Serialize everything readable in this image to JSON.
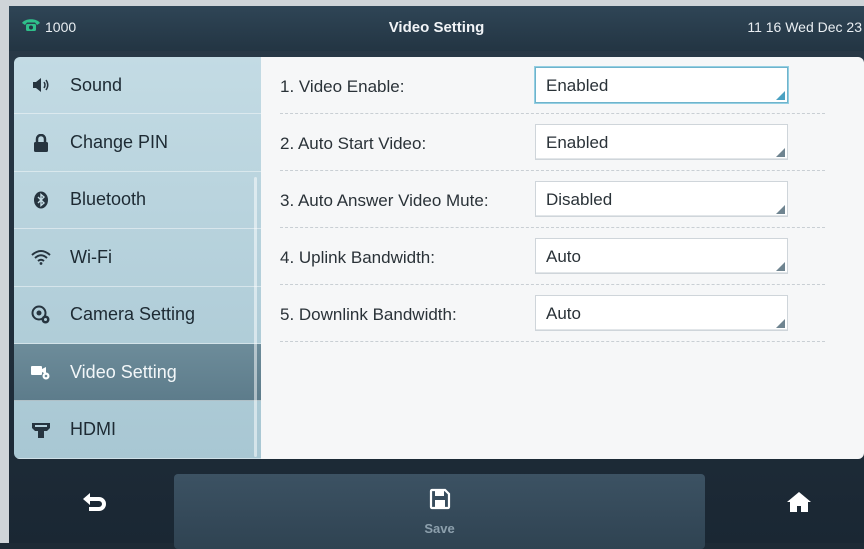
{
  "topbar": {
    "line_number": "1000",
    "title": "Video Setting",
    "clock": "11 16 Wed Dec 23"
  },
  "sidebar": {
    "items": [
      {
        "label": "Sound",
        "icon": "speaker-icon"
      },
      {
        "label": "Change PIN",
        "icon": "lock-icon"
      },
      {
        "label": "Bluetooth",
        "icon": "bluetooth-icon"
      },
      {
        "label": "Wi-Fi",
        "icon": "wifi-icon"
      },
      {
        "label": "Camera Setting",
        "icon": "camera-gear-icon"
      },
      {
        "label": "Video Setting",
        "icon": "video-gear-icon",
        "active": true
      },
      {
        "label": "HDMI",
        "icon": "hdmi-icon"
      }
    ]
  },
  "settings": {
    "rows": [
      {
        "label": "1. Video Enable:",
        "value": "Enabled"
      },
      {
        "label": "2. Auto Start Video:",
        "value": "Enabled"
      },
      {
        "label": "3. Auto Answer Video Mute:",
        "value": "Disabled"
      },
      {
        "label": "4. Uplink Bandwidth:",
        "value": "Auto"
      },
      {
        "label": "5. Downlink Bandwidth:",
        "value": "Auto"
      }
    ]
  },
  "softkeys": {
    "save_label": "Save"
  },
  "colors": {
    "accent": "#6fb3cc",
    "phone_icon": "#2fbf8a",
    "active_item": "#6d8c9a"
  }
}
